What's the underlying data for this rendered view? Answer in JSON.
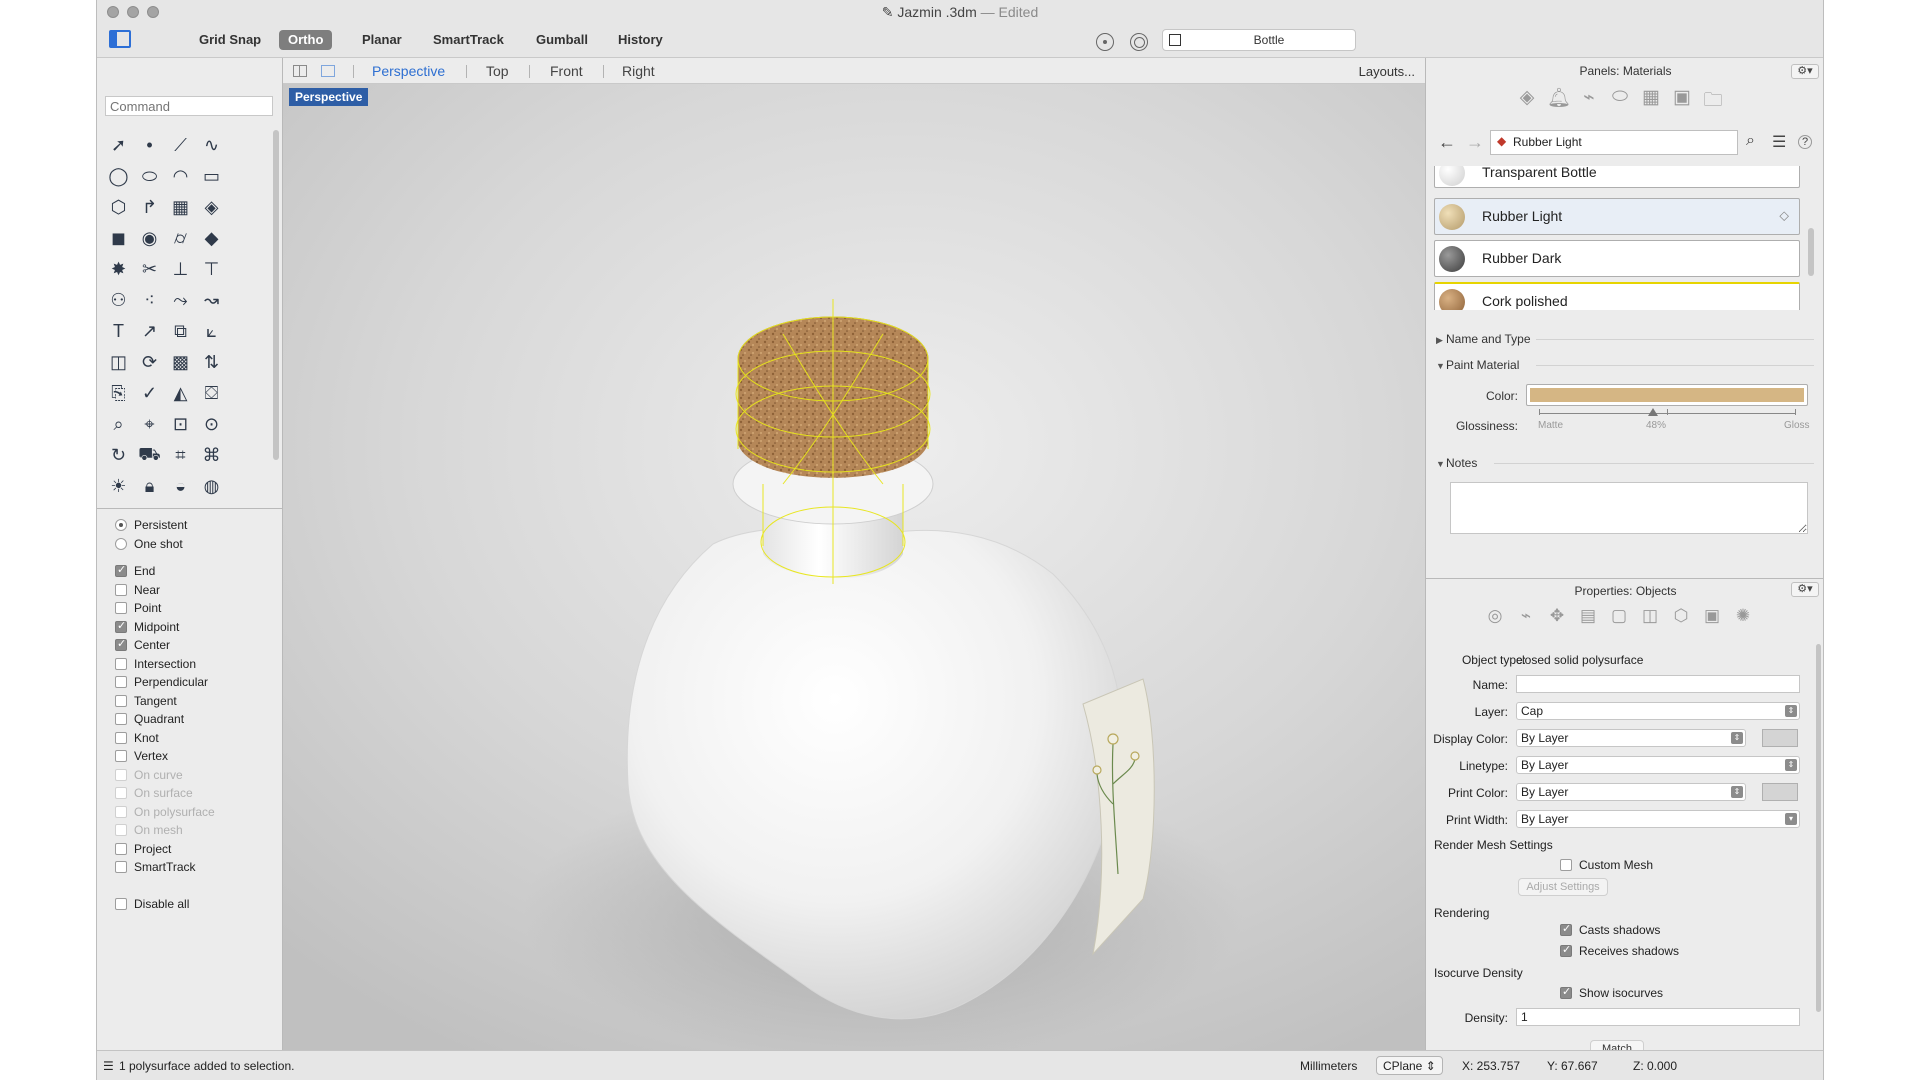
{
  "window": {
    "title": "Jazmin .3dm",
    "title_suffix": "— Edited"
  },
  "toolbar": {
    "buttons": [
      "Grid Snap",
      "Ortho",
      "Planar",
      "SmartTrack",
      "Gumball",
      "History"
    ],
    "active_button": "Ortho",
    "current_layer": "Bottle"
  },
  "left_panel": {
    "command_placeholder": "Command",
    "osnap_mode": [
      {
        "label": "Persistent",
        "selected": true
      },
      {
        "label": "One shot",
        "selected": false
      }
    ],
    "osnaps": [
      {
        "label": "End",
        "checked": true,
        "enabled": true
      },
      {
        "label": "Near",
        "checked": false,
        "enabled": true
      },
      {
        "label": "Point",
        "checked": false,
        "enabled": true
      },
      {
        "label": "Midpoint",
        "checked": true,
        "enabled": true
      },
      {
        "label": "Center",
        "checked": true,
        "enabled": true
      },
      {
        "label": "Intersection",
        "checked": false,
        "enabled": true
      },
      {
        "label": "Perpendicular",
        "checked": false,
        "enabled": true
      },
      {
        "label": "Tangent",
        "checked": false,
        "enabled": true
      },
      {
        "label": "Quadrant",
        "checked": false,
        "enabled": true
      },
      {
        "label": "Knot",
        "checked": false,
        "enabled": true
      },
      {
        "label": "Vertex",
        "checked": false,
        "enabled": true
      },
      {
        "label": "On curve",
        "checked": false,
        "enabled": false
      },
      {
        "label": "On surface",
        "checked": false,
        "enabled": false
      },
      {
        "label": "On polysurface",
        "checked": false,
        "enabled": false
      },
      {
        "label": "On mesh",
        "checked": false,
        "enabled": false
      },
      {
        "label": "Project",
        "checked": false,
        "enabled": true
      },
      {
        "label": "SmartTrack",
        "checked": false,
        "enabled": true
      }
    ],
    "disable_all": "Disable all"
  },
  "viewport": {
    "tabs": [
      "Perspective",
      "Top",
      "Front",
      "Right"
    ],
    "active_tab": "Perspective",
    "layouts_button": "Layouts...",
    "label": "Perspective"
  },
  "materials_panel": {
    "title": "Panels: Materials",
    "search_value": "Rubber Light",
    "materials": [
      {
        "name": "Transparent Bottle",
        "thumb": "#e4e4e4",
        "selected": false
      },
      {
        "name": "Rubber Light",
        "thumb": "#cfb98f",
        "selected": true
      },
      {
        "name": "Rubber Dark",
        "thumb": "#555555",
        "selected": false
      },
      {
        "name": "Cork polished",
        "thumb": "#b58758",
        "selected": false
      }
    ],
    "sections": {
      "name_type": "Name and Type",
      "paint": "Paint Material",
      "notes": "Notes"
    },
    "color_label": "Color:",
    "color_value": "#d5b684",
    "glossiness_label": "Glossiness:",
    "glossiness_min": "Matte",
    "glossiness_value": "48%",
    "glossiness_max": "Gloss",
    "glossiness": 0.48
  },
  "properties_panel": {
    "title": "Properties: Objects",
    "object_type_label": "Object type:",
    "object_type": "closed solid polysurface",
    "name_label": "Name:",
    "name_value": "",
    "layer_label": "Layer:",
    "layer_value": "Cap",
    "display_color_label": "Display Color:",
    "display_color_value": "By Layer",
    "linetype_label": "Linetype:",
    "linetype_value": "By Layer",
    "print_color_label": "Print Color:",
    "print_color_value": "By Layer",
    "print_width_label": "Print Width:",
    "print_width_value": "By Layer",
    "render_mesh_heading": "Render Mesh Settings",
    "custom_mesh": "Custom Mesh",
    "adjust_settings": "Adjust Settings",
    "rendering_heading": "Rendering",
    "casts_shadows": "Casts shadows",
    "receives_shadows": "Receives shadows",
    "isocurve_heading": "Isocurve Density",
    "show_isocurves": "Show isocurves",
    "density_label": "Density:",
    "density_value": "1",
    "match_button": "Match"
  },
  "statusbar": {
    "message": "1 polysurface added to selection.",
    "units": "Millimeters",
    "cplane": "CPlane",
    "x": "X: 253.757",
    "y": "Y: 67.667",
    "z": "Z: 0.000"
  },
  "colors": {
    "accent": "#2e6fd1",
    "viewport_label_bg": "#2e5ea6",
    "cork": "#b58758",
    "isocurve": "#e8e61a"
  }
}
